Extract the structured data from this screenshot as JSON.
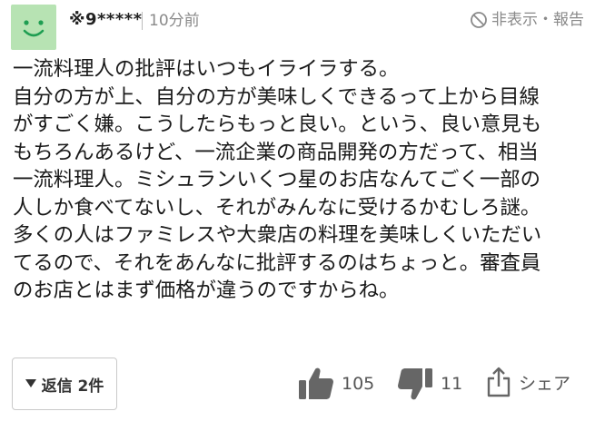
{
  "user": {
    "name": "※9*****",
    "time": "10分前"
  },
  "header": {
    "hide_report_label": "非表示・報告"
  },
  "comment": {
    "lines": [
      "一流料理人の批評はいつもイライラする。",
      "自分の方が上、自分の方が美味しくできるって上から目線",
      "がすごく嫌。こうしたらもっと良い。という、良い意見も",
      "もちろんあるけど、一流企業の商品開発の方だって、相当",
      "一流料理人。ミシュランいくつ星のお店なんてごく一部の",
      "人しか食べてないし、それがみんなに受けるかむしろ謎。",
      "多くの人はファミレスや大衆店の料理を美味しくいただい",
      "てるので、それをあんなに批評するのはちょっと。審査員",
      "のお店とはまず価格が違うのですからね。"
    ]
  },
  "footer": {
    "reply_label": "返信 2件",
    "like_count": "105",
    "dislike_count": "11",
    "share_label": "シェア"
  },
  "colors": {
    "avatar_bg": "#b7e3b3",
    "icon_gray": "#666666",
    "meta_gray": "#8a8a8a"
  }
}
